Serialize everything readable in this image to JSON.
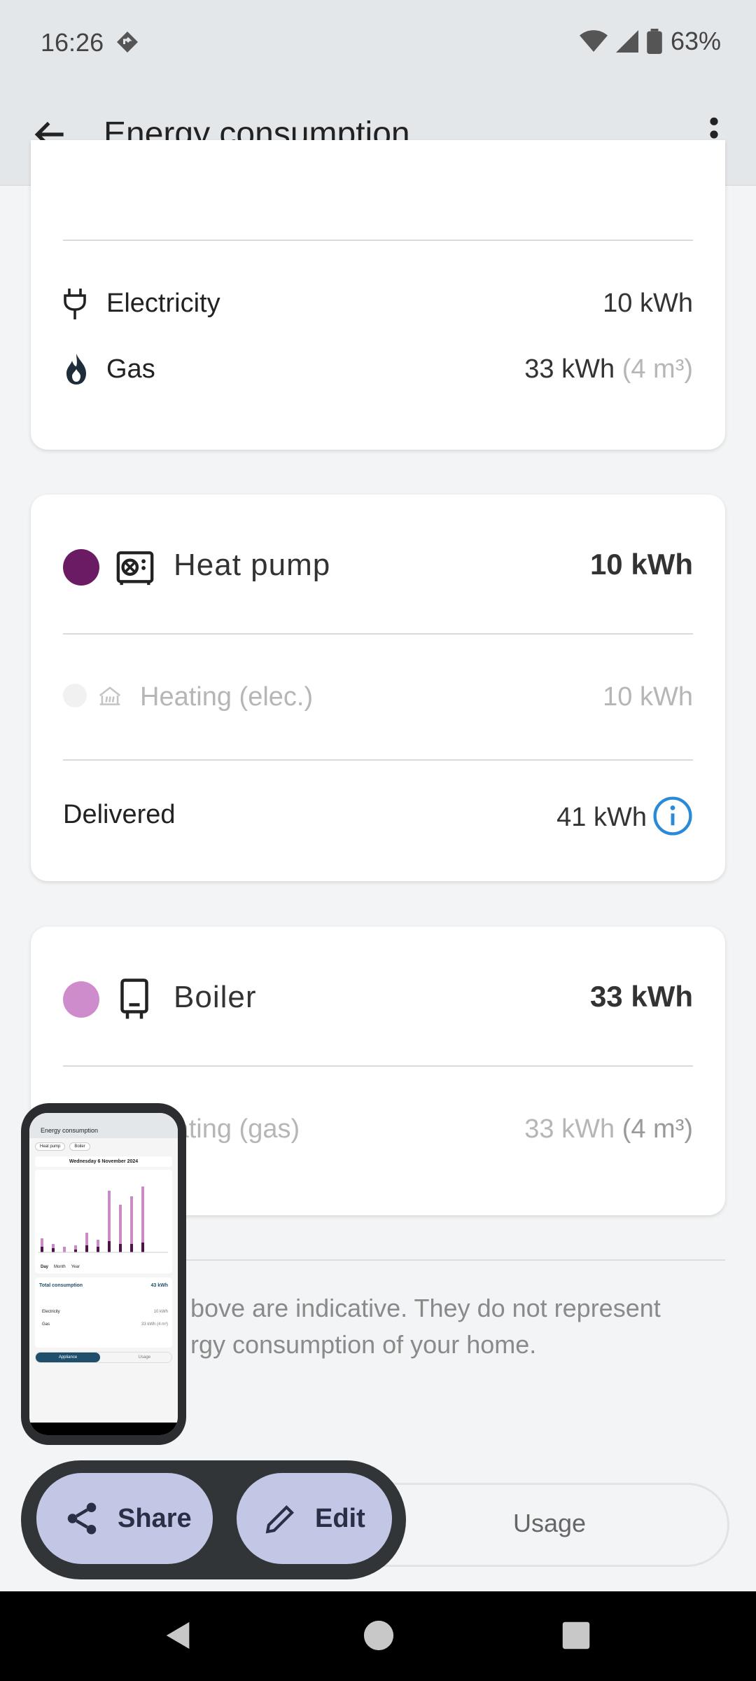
{
  "status_bar": {
    "time": "16:26",
    "battery": "63%"
  },
  "app_bar": {
    "title": "Energy consumption"
  },
  "summary": {
    "total_label_partial": "Total consumption",
    "total_value_partial": "43 kWh",
    "electricity": {
      "label": "Electricity",
      "value": "10 kWh"
    },
    "gas": {
      "label": "Gas",
      "value": "33 kWh",
      "extra": "(4 m³)"
    }
  },
  "heat_pump": {
    "name": "Heat pump",
    "total": "10 kWh",
    "color": "#6a1b63",
    "sub": {
      "label": "Heating (elec.)",
      "value": "10 kWh"
    },
    "delivered": {
      "label": "Delivered",
      "value": "41 kWh"
    }
  },
  "boiler": {
    "name": "Boiler",
    "total": "33 kWh",
    "color": "#cf8ccc",
    "sub": {
      "label": "Heating (gas)",
      "value": "33 kWh",
      "extra": "(4 m³)"
    }
  },
  "footnote": {
    "line1": "bove are indicative. They do not represent",
    "line2": "rgy consumption of your home."
  },
  "segmented": {
    "usage": "Usage"
  },
  "fabs": {
    "share": "Share",
    "edit": "Edit"
  },
  "thumbnail": {
    "title": "Energy consumption",
    "chip1": "Heat pump",
    "chip2": "Boiler",
    "date": "Wednesday 6 November 2024",
    "tabs": [
      "Day",
      "Month",
      "Year"
    ],
    "total_label": "Total consumption",
    "total_value": "43 kWh",
    "elec": "Electricity",
    "elec_value": "10 kWh",
    "gas": "Gas",
    "gas_value": "33 kWh (4 m³)",
    "seg1": "Appliance",
    "seg2": "Usage"
  }
}
